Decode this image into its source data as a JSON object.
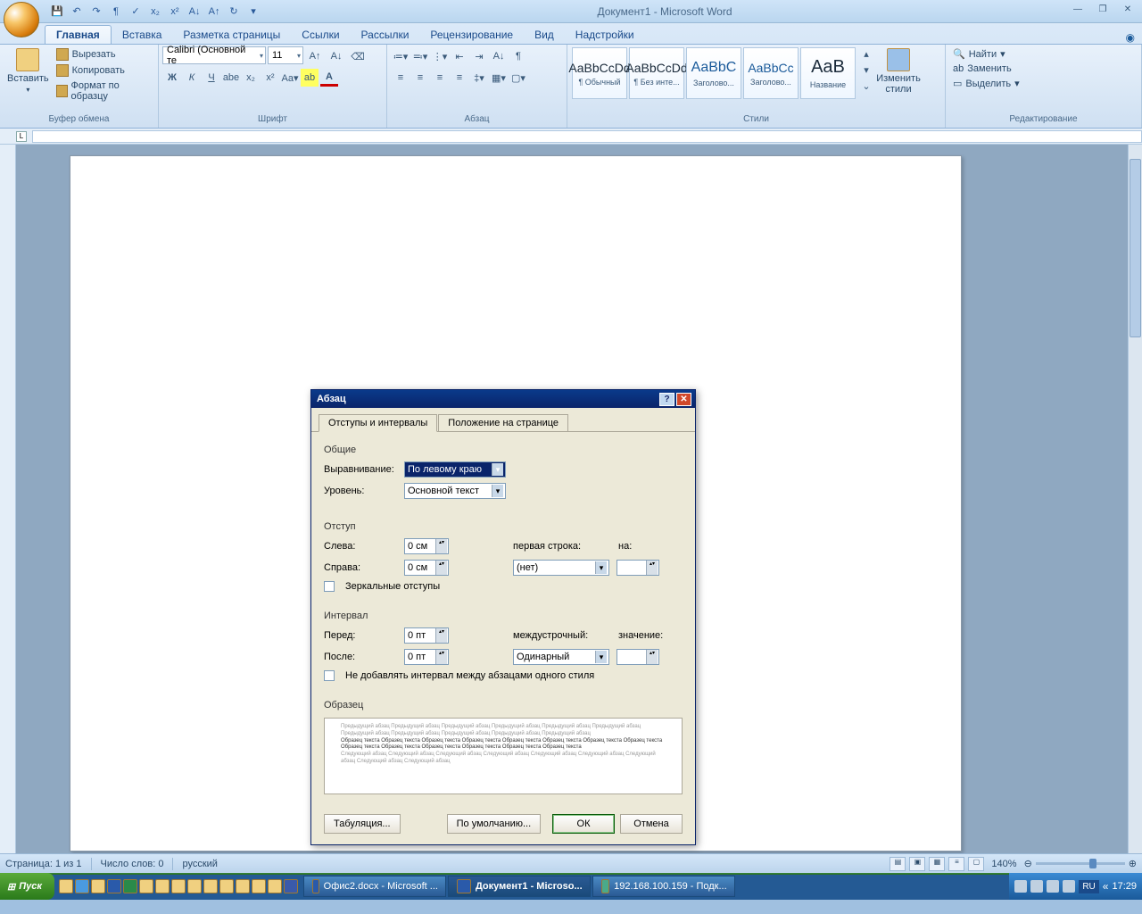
{
  "title": "Документ1 - Microsoft Word",
  "qat_icons": [
    "save",
    "undo",
    "redo",
    "¶",
    "abc",
    "x₂",
    "x²",
    "A↓",
    "A↑",
    "Aa"
  ],
  "tabs": [
    "Главная",
    "Вставка",
    "Разметка страницы",
    "Ссылки",
    "Рассылки",
    "Рецензирование",
    "Вид",
    "Надстройки"
  ],
  "ribbon": {
    "clipboard": {
      "paste": "Вставить",
      "cut": "Вырезать",
      "copy": "Копировать",
      "format": "Формат по образцу",
      "label": "Буфер обмена"
    },
    "font": {
      "family": "Calibri (Основной те",
      "size": "11",
      "label": "Шрифт"
    },
    "paragraph": {
      "label": "Абзац"
    },
    "styles": {
      "items": [
        {
          "sample": "AaBbCcDd",
          "name": "¶ Обычный"
        },
        {
          "sample": "AaBbCcDd",
          "name": "¶ Без инте..."
        },
        {
          "sample": "AaBbC",
          "name": "Заголово..."
        },
        {
          "sample": "AaBbCc",
          "name": "Заголово..."
        },
        {
          "sample": "AaB",
          "name": "Название"
        }
      ],
      "change": "Изменить стили",
      "label": "Стили"
    },
    "editing": {
      "find": "Найти",
      "replace": "Заменить",
      "select": "Выделить",
      "label": "Редактирование"
    }
  },
  "dialog": {
    "title": "Абзац",
    "tab1": "Отступы и интервалы",
    "tab2": "Положение на странице",
    "general": "Общие",
    "alignment_label": "Выравнивание:",
    "alignment_value": "По левому краю",
    "level_label": "Уровень:",
    "level_value": "Основной текст",
    "indent": "Отступ",
    "left_label": "Слева:",
    "left_value": "0 см",
    "right_label": "Справа:",
    "right_value": "0 см",
    "firstline_label": "первая строка:",
    "firstline_value": "(нет)",
    "by_label": "на:",
    "mirror": "Зеркальные отступы",
    "spacing": "Интервал",
    "before_label": "Перед:",
    "before_value": "0 пт",
    "after_label": "После:",
    "after_value": "0 пт",
    "linespacing_label": "междустрочный:",
    "linespacing_value": "Одинарный",
    "at_label": "значение:",
    "noadd": "Не добавлять интервал между абзацами одного стиля",
    "preview": "Образец",
    "preview_prev": "Предыдущий абзац Предыдущий абзац Предыдущий абзац Предыдущий абзац Предыдущий абзац Предыдущий абзац Предыдущий абзац Предыдущий абзац Предыдущий абзац Предыдущий абзац Предыдущий абзац",
    "preview_curr": "Образец текста Образец текста Образец текста Образец текста Образец текста Образец текста Образец текста Образец текста Образец текста Образец текста Образец текста Образец текста Образец текста Образец текста",
    "preview_next": "Следующий абзац Следующий абзац Следующий абзац Следующий абзац Следующий абзац Следующий абзац Следующий абзац Следующий абзац Следующий абзац",
    "tabs_btn": "Табуляция...",
    "default_btn": "По умолчанию...",
    "ok": "ОК",
    "cancel": "Отмена"
  },
  "status": {
    "page": "Страница: 1 из 1",
    "words": "Число слов: 0",
    "lang": "русский",
    "zoom": "140%"
  },
  "taskbar": {
    "start": "Пуск",
    "tasks": [
      {
        "label": "Офис2.docx - Microsoft ..."
      },
      {
        "label": "Документ1 - Microso..."
      },
      {
        "label": "192.168.100.159 - Подк..."
      }
    ],
    "lang": "RU",
    "ql_icon": "«",
    "clock": "17:29"
  }
}
